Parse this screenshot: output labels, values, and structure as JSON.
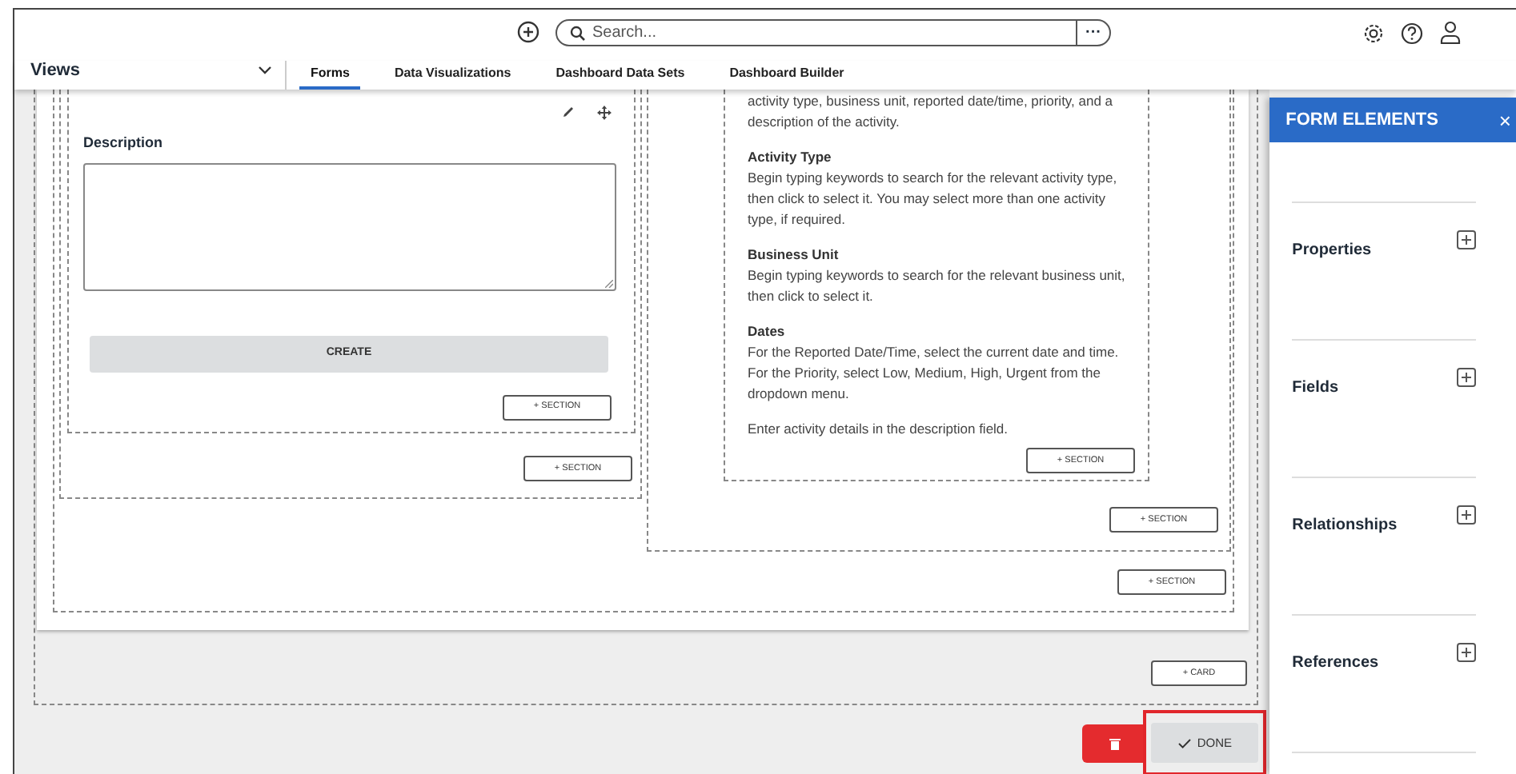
{
  "topbar": {
    "search_placeholder": "Search...",
    "more": "···"
  },
  "views": {
    "label": "Views"
  },
  "tabs": [
    {
      "label": "Forms",
      "selected": true
    },
    {
      "label": "Data Visualizations",
      "selected": false
    },
    {
      "label": "Dashboard Data Sets",
      "selected": false
    },
    {
      "label": "Dashboard Builder",
      "selected": false
    }
  ],
  "left_column": {
    "field_label": "Description",
    "create_button": "CREATE",
    "inner_section_button": "+ SECTION",
    "section_button": "+ SECTION"
  },
  "right_column": {
    "help": [
      {
        "text": "activity type, business unit, reported date/time, priority, and a description of the activity."
      },
      {
        "heading": "Activity Type",
        "text": "Begin typing keywords to search for the relevant activity type, then click to select it. You may select more than one activity type, if required."
      },
      {
        "heading": "Business Unit",
        "text": "Begin typing keywords to search for the relevant business unit, then click to select it."
      },
      {
        "heading": "Dates",
        "text": "For the Reported Date/Time, select the current date and time. For the Priority, select Low, Medium, High, Urgent from the dropdown menu."
      },
      {
        "text": "Enter activity details in the description field."
      }
    ],
    "inner_section_button": "+ SECTION",
    "section_button": "+ SECTION"
  },
  "section_button": "+ SECTION",
  "card_button": "+ CARD",
  "done_button": "DONE",
  "panel": {
    "title": "FORM ELEMENTS",
    "close": "×",
    "groups": [
      {
        "label": "Properties"
      },
      {
        "label": "Fields"
      },
      {
        "label": "Relationships"
      },
      {
        "label": "References"
      }
    ]
  }
}
